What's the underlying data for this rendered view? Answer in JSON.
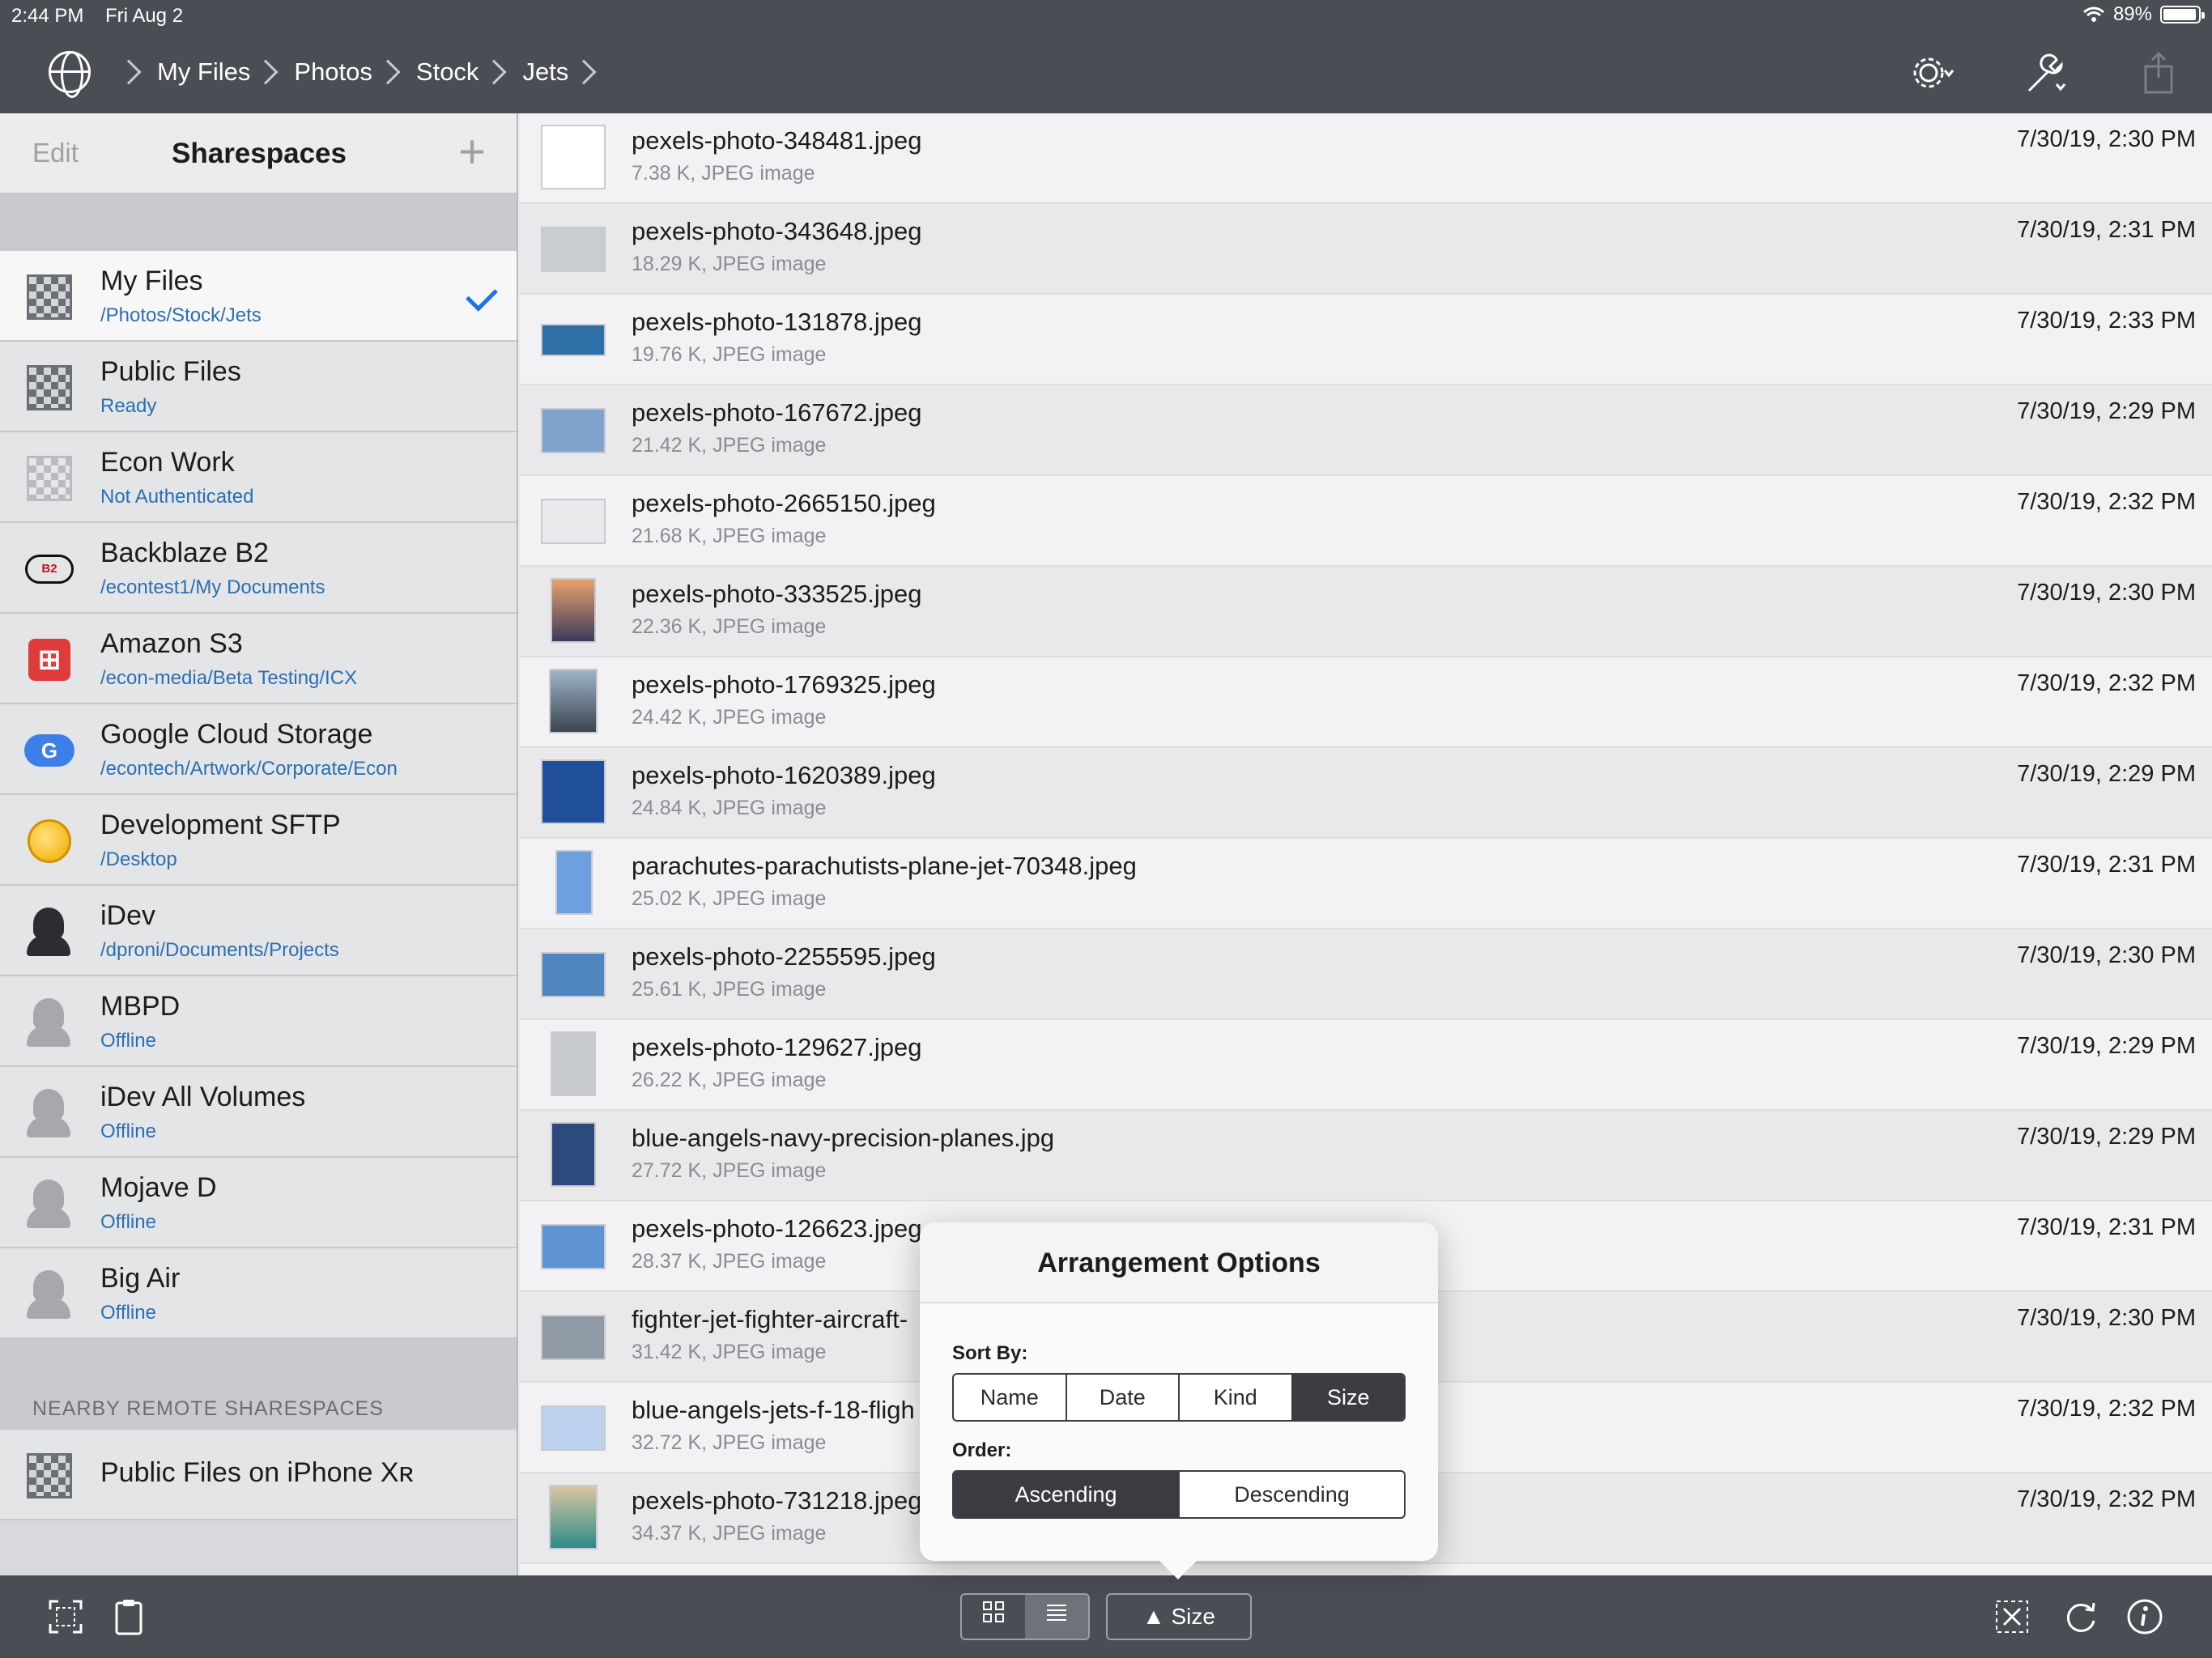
{
  "status": {
    "time": "2:44 PM",
    "date": "Fri Aug 2",
    "battery": "89%"
  },
  "breadcrumb": [
    "My Files",
    "Photos",
    "Stock",
    "Jets"
  ],
  "sidebar": {
    "edit": "Edit",
    "title": "Sharespaces",
    "items": [
      {
        "name": "My Files",
        "sub": "/Photos/Stock/Jets",
        "icon": "puzzle-icon"
      },
      {
        "name": "Public Files",
        "sub": "Ready",
        "icon": "puzzle-icon"
      },
      {
        "name": "Econ Work",
        "sub": "Not Authenticated",
        "icon": "puzzle-icon"
      },
      {
        "name": "Backblaze B2",
        "sub": "/econtest1/My Documents",
        "icon": "backblaze-icon"
      },
      {
        "name": "Amazon S3",
        "sub": "/econ-media/Beta Testing/ICX",
        "icon": "amazon-s3-icon"
      },
      {
        "name": "Google Cloud Storage",
        "sub": "/econtech/Artwork/Corporate/Econ",
        "icon": "google-cloud-icon"
      },
      {
        "name": "Development SFTP",
        "sub": "/Desktop",
        "icon": "sftp-globe-icon"
      },
      {
        "name": "iDev",
        "sub": "/dproni/Documents/Projects",
        "icon": "spy-icon"
      },
      {
        "name": "MBPD",
        "sub": "Offline",
        "icon": "spy-icon"
      },
      {
        "name": "iDev All Volumes",
        "sub": "Offline",
        "icon": "spy-icon"
      },
      {
        "name": "Mojave D",
        "sub": "Offline",
        "icon": "spy-icon"
      },
      {
        "name": "Big Air",
        "sub": "Offline",
        "icon": "spy-icon"
      }
    ],
    "nearby_header": "NEARBY REMOTE SHARESPACES",
    "nearby_items": [
      {
        "name": "Public Files on iPhone Xʀ"
      }
    ]
  },
  "files": [
    {
      "name": "pexels-photo-348481.jpeg",
      "meta": "7.38 K, JPEG image",
      "date": "7/30/19, 2:30 PM"
    },
    {
      "name": "pexels-photo-343648.jpeg",
      "meta": "18.29 K, JPEG image",
      "date": "7/30/19, 2:31 PM"
    },
    {
      "name": "pexels-photo-131878.jpeg",
      "meta": "19.76 K, JPEG image",
      "date": "7/30/19, 2:33 PM"
    },
    {
      "name": "pexels-photo-167672.jpeg",
      "meta": "21.42 K, JPEG image",
      "date": "7/30/19, 2:29 PM"
    },
    {
      "name": "pexels-photo-2665150.jpeg",
      "meta": "21.68 K, JPEG image",
      "date": "7/30/19, 2:32 PM"
    },
    {
      "name": "pexels-photo-333525.jpeg",
      "meta": "22.36 K, JPEG image",
      "date": "7/30/19, 2:30 PM"
    },
    {
      "name": "pexels-photo-1769325.jpeg",
      "meta": "24.42 K, JPEG image",
      "date": "7/30/19, 2:32 PM"
    },
    {
      "name": "pexels-photo-1620389.jpeg",
      "meta": "24.84 K, JPEG image",
      "date": "7/30/19, 2:29 PM"
    },
    {
      "name": "parachutes-parachutists-plane-jet-70348.jpeg",
      "meta": "25.02 K, JPEG image",
      "date": "7/30/19, 2:31 PM"
    },
    {
      "name": "pexels-photo-2255595.jpeg",
      "meta": "25.61 K, JPEG image",
      "date": "7/30/19, 2:30 PM"
    },
    {
      "name": "pexels-photo-129627.jpeg",
      "meta": "26.22 K, JPEG image",
      "date": "7/30/19, 2:29 PM"
    },
    {
      "name": "blue-angels-navy-precision-planes.jpg",
      "meta": "27.72 K, JPEG image",
      "date": "7/30/19, 2:29 PM"
    },
    {
      "name": "pexels-photo-126623.jpeg",
      "meta": "28.37 K, JPEG image",
      "date": "7/30/19, 2:31 PM"
    },
    {
      "name": "fighter-jet-fighter-aircraft-",
      "meta": "31.42 K, JPEG image",
      "date": "7/30/19, 2:30 PM"
    },
    {
      "name": "blue-angels-jets-f-18-fligh",
      "meta": "32.72 K, JPEG image",
      "date": "7/30/19, 2:32 PM"
    },
    {
      "name": "pexels-photo-731218.jpeg",
      "meta": "34.37 K, JPEG image",
      "date": "7/30/19, 2:32 PM"
    }
  ],
  "popover": {
    "title": "Arrangement Options",
    "sort_label": "Sort By:",
    "sort_options": [
      "Name",
      "Date",
      "Kind",
      "Size"
    ],
    "sort_selected": "Size",
    "order_label": "Order:",
    "order_options": [
      "Ascending",
      "Descending"
    ],
    "order_selected": "Ascending"
  },
  "toolbar": {
    "sort_button": "▲ Size"
  },
  "colors": {
    "bar": "#4a4d54",
    "accent": "#1a73e8",
    "sub_text": "#2a6fb3"
  }
}
